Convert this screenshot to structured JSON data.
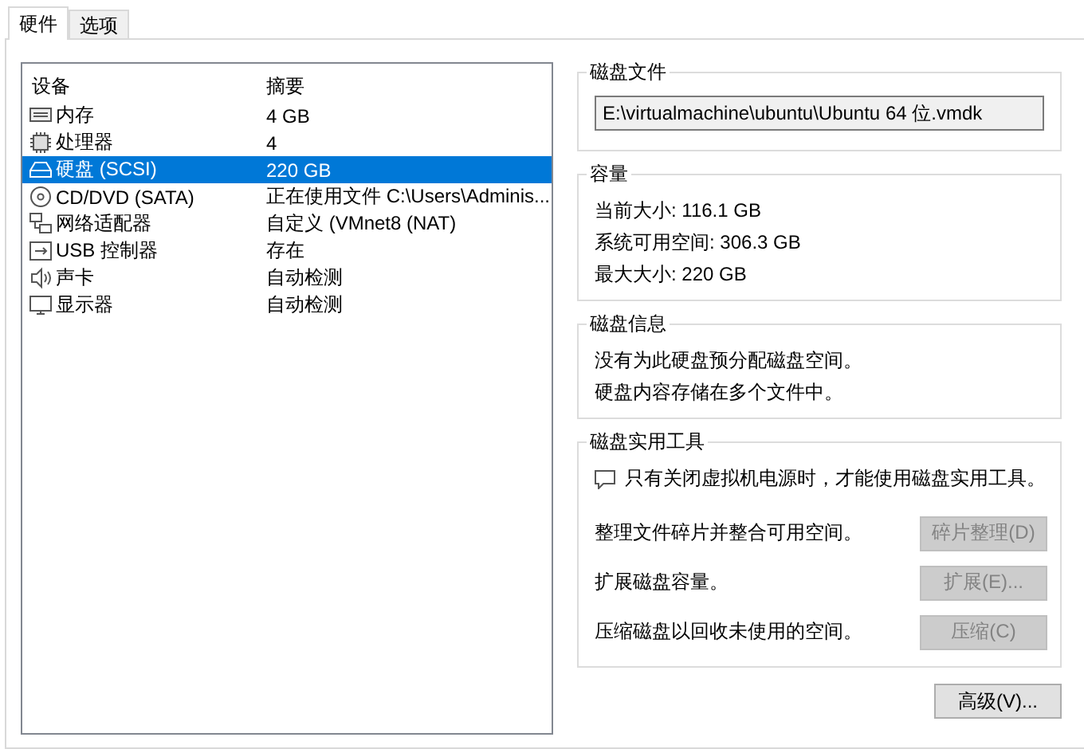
{
  "tabs": [
    {
      "label": "硬件",
      "selected": true
    },
    {
      "label": "选项",
      "selected": false
    }
  ],
  "device_list": {
    "columns": [
      "设备",
      "摘要"
    ],
    "rows": [
      {
        "kind": "memory",
        "device": "内存",
        "summary": "4 GB",
        "selected": false
      },
      {
        "kind": "cpu",
        "device": "处理器",
        "summary": "4",
        "selected": false
      },
      {
        "kind": "disk",
        "device": "硬盘 (SCSI)",
        "summary": "220 GB",
        "selected": true
      },
      {
        "kind": "cdrom",
        "device": "CD/DVD (SATA)",
        "summary": "正在使用文件 C:\\Users\\Adminis...",
        "selected": false
      },
      {
        "kind": "network",
        "device": "网络适配器",
        "summary": "自定义 (VMnet8 (NAT)",
        "selected": false
      },
      {
        "kind": "usb",
        "device": "USB 控制器",
        "summary": "存在",
        "selected": false
      },
      {
        "kind": "sound",
        "device": "声卡",
        "summary": "自动检测",
        "selected": false
      },
      {
        "kind": "display",
        "device": "显示器",
        "summary": "自动检测",
        "selected": false
      }
    ]
  },
  "disk_file": {
    "title": "磁盘文件",
    "value": "E:\\virtualmachine\\ubuntu\\Ubuntu 64 位.vmdk"
  },
  "capacity": {
    "title": "容量",
    "lines": [
      "当前大小: 116.1 GB",
      "系统可用空间: 306.3 GB",
      "最大大小: 220 GB"
    ]
  },
  "disk_info": {
    "title": "磁盘信息",
    "lines": [
      "没有为此硬盘预分配磁盘空间。",
      "硬盘内容存储在多个文件中。"
    ]
  },
  "disk_utilities": {
    "title": "磁盘实用工具",
    "note": "只有关闭虚拟机电源时，才能使用磁盘实用工具。",
    "actions": [
      {
        "description": "整理文件碎片并整合可用空间。",
        "button": "碎片整理(D)",
        "disabled": true
      },
      {
        "description": "扩展磁盘容量。",
        "button": "扩展(E)...",
        "disabled": true
      },
      {
        "description": "压缩磁盘以回收未使用的空间。",
        "button": "压缩(C)",
        "disabled": true
      }
    ]
  },
  "advanced_button": {
    "label": "高级(V)...",
    "disabled": false
  }
}
